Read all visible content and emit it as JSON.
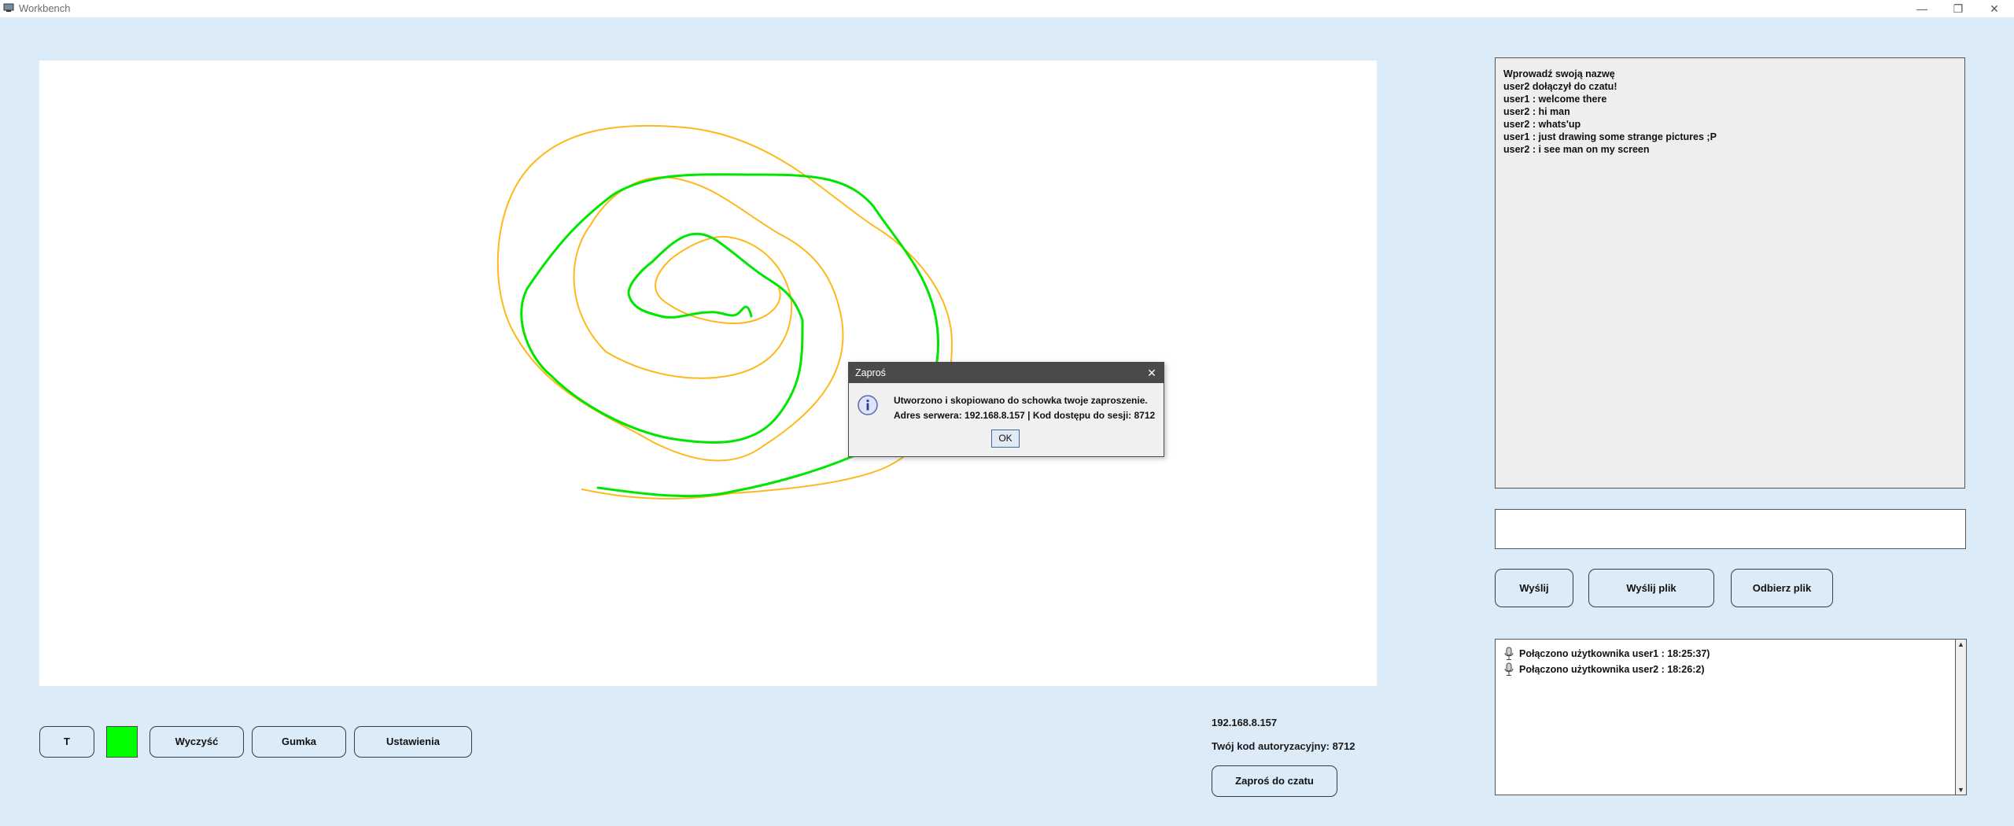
{
  "window": {
    "title": "Workbench",
    "minimize_glyph": "—",
    "restore_glyph": "❐",
    "close_glyph": "✕"
  },
  "toolbar": {
    "text_tool_label": "T",
    "current_color": "#00ff00",
    "clear_label": "Wyczyść",
    "eraser_label": "Gumka",
    "settings_label": "Ustawienia"
  },
  "server_info": {
    "address": "192.168.8.157",
    "auth_code_text": "Twój kod autoryzacyjny: 8712",
    "invite_label": "Zaproś do czatu"
  },
  "chat": {
    "messages": [
      "Wprowadź swoją nazwę",
      "user2 dołączył do czatu!",
      "user1 : welcome there",
      "user2 : hi man",
      "user2 : whats'up",
      "user1 : just drawing some strange pictures ;P",
      "user2 : i see man on my screen"
    ],
    "input_value": "",
    "send_label": "Wyślij",
    "send_file_label": "Wyślij plik",
    "receive_file_label": "Odbierz plik"
  },
  "users": {
    "rows": [
      "Połączono użytkownika user1 : 18:25:37)",
      "Połączono użytkownika user2 : 18:26:2)"
    ],
    "icon": "microphone-icon"
  },
  "dialog": {
    "title": "Zaproś",
    "line1": "Utworzono i skopiowano do schowka twoje zaproszenie.",
    "line2": "Adres serwera: 192.168.8.157 | Kod dostępu do sesji: 8712",
    "ok_label": "OK",
    "icon": "info-icon"
  },
  "drawing": {
    "stroke_colors": [
      "#ffb81c",
      "#00e600"
    ]
  }
}
